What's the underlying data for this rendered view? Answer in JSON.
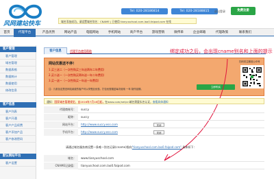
{
  "brand": {
    "logo_text": "风网建站快车"
  },
  "header": {
    "tel1": "Tel: 020-28186814",
    "tel2": "Tel: 020-28188815",
    "notice": "域名添加成功，请设置域名别名：CNAME | 已使用 tianyuschool.com.lao0.faipod.com 在找",
    "logout": "退出登录",
    "free_button": "免费注册"
  },
  "nav": {
    "items": [
      "首页",
      "代理平台",
      "产品优势",
      "网站产品",
      "电脑网站",
      "手机网站",
      "商户平台",
      "游戏营销",
      "微传单",
      "企业邮箱",
      "代理政策",
      "联系我们"
    ]
  },
  "sidebar": {
    "groups": [
      {
        "title": "客户管理",
        "items": [
          "客户管理",
          "域名管理",
          "数据表格",
          "数据统计",
          "数据使用",
          "修改信息"
        ]
      },
      {
        "title": "客户信息",
        "items": [
          "客户列表",
          "客户开通",
          "客户产品续费",
          "客户添加产品",
          "客户修改密码"
        ]
      },
      {
        "title": "默认网站平台",
        "items": [
          "客户设置"
        ]
      }
    ]
  },
  "tabs": {
    "info": "客户信息",
    "help": "代理平台使用帮助"
  },
  "promo": {
    "title": "网站优惠送不停！",
    "line1": "1.买三送二（一次性购买三年送两年二年费用）",
    "line2": "2.买二送一（一次性购买两年送一年二年费用）",
    "line3": "3.买一送一（一次性购买一年送一年费用）",
    "note": "注：凡参加这是旧网站续费的客户可以享受此优惠。打包优惠赠送每次使用 一年 制作延期。",
    "qr_label": "扫码关注微信公众号",
    "green_button": "立即购买"
  },
  "annotation": "绑定成功之后，会出现cname别名和上面的提示",
  "notice2": {
    "label": "通知：",
    "red": "国家域名管理规定，自2016年7月18日起，",
    "text": "在www.com/net/cn域名需要实名认证，",
    "link": "查看具体通知"
  },
  "form": {
    "rows": [
      {
        "label": "代理商帐号：",
        "value": "succy"
      },
      {
        "label": "昵称：",
        "value": "succy"
      },
      {
        "label": "网站平台：",
        "value": "http://www.succy.ess.com",
        "button": "关闭"
      },
      {
        "label": "手机平台：",
        "value": "http://www.succy.ess.com",
        "button": "关闭"
      }
    ],
    "hint_pre": "请通过域名服务商设置一条唯一别名记录(cname)指向",
    "hint_link": "\"tianyuschool.com.lao0.faipod.com\"",
    "hint_post": ",具体如下：",
    "domain_label": "域名：",
    "domain_value": "www.tianyuschool.com",
    "cname_label": "CNAME记录值：",
    "cname_value": "tianyuschool.com.lao0.faipod.com"
  }
}
